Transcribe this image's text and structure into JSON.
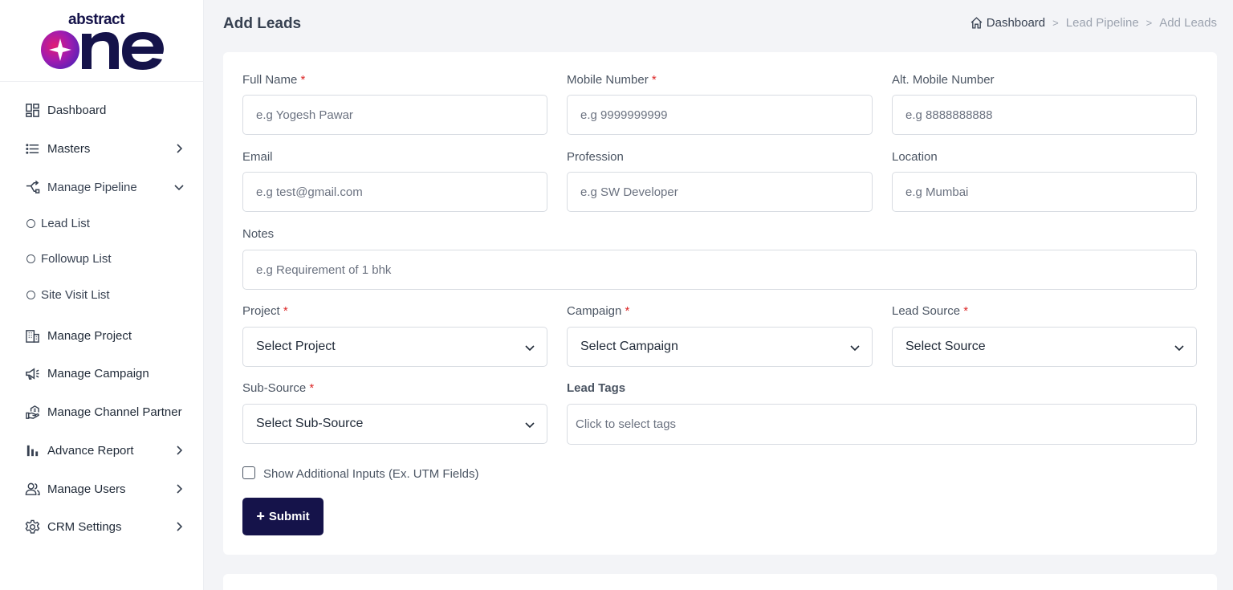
{
  "app": {
    "logo_top": "abstract",
    "logo_bottom": "one"
  },
  "sidebar": {
    "items": [
      {
        "label": "Dashboard",
        "icon": "dashboard-icon"
      },
      {
        "label": "Masters",
        "icon": "list-icon"
      },
      {
        "label": "Manage Pipeline",
        "icon": "pipeline-icon"
      },
      {
        "label": "Manage Project",
        "icon": "building-icon"
      },
      {
        "label": "Manage Campaign",
        "icon": "megaphone-icon"
      },
      {
        "label": "Manage Channel Partner",
        "icon": "handshake-icon"
      },
      {
        "label": "Advance Report",
        "icon": "bar-chart-icon"
      },
      {
        "label": "Manage Users",
        "icon": "users-icon"
      },
      {
        "label": "CRM Settings",
        "icon": "gear-icon"
      }
    ],
    "pipeline_sub": [
      "Lead List",
      "Followup List",
      "Site Visit List"
    ]
  },
  "header": {
    "title": "Add Leads",
    "breadcrumb": [
      "Dashboard",
      "Lead Pipeline",
      "Add Leads"
    ],
    "sep": ">"
  },
  "form": {
    "full_name": {
      "label": "Full Name",
      "placeholder": "e.g Yogesh Pawar",
      "required": "*"
    },
    "mobile": {
      "label": "Mobile Number",
      "placeholder": "e.g 9999999999",
      "required": "*"
    },
    "alt_mobile": {
      "label": "Alt. Mobile Number",
      "placeholder": "e.g 8888888888"
    },
    "email": {
      "label": "Email",
      "placeholder": "e.g test@gmail.com"
    },
    "profession": {
      "label": "Profession",
      "placeholder": "e.g SW Developer"
    },
    "location": {
      "label": "Location",
      "placeholder": "e.g Mumbai"
    },
    "notes": {
      "label": "Notes",
      "placeholder": "e.g Requirement of 1 bhk"
    },
    "project": {
      "label": "Project",
      "value": "Select Project",
      "required": "*"
    },
    "campaign": {
      "label": "Campaign",
      "value": "Select Campaign",
      "required": "*"
    },
    "lead_source": {
      "label": "Lead Source",
      "value": "Select Source",
      "required": "*"
    },
    "sub_source": {
      "label": "Sub-Source",
      "value": "Select Sub-Source",
      "required": "*"
    },
    "lead_tags": {
      "label": "Lead Tags",
      "placeholder": "Click to select tags"
    },
    "additional_inputs": "Show Additional Inputs (Ex. UTM Fields)",
    "submit_label": "Submit",
    "submit_icon": "+"
  },
  "colors": {
    "primary": "#15134a",
    "required": "#dc2626",
    "logo_gradient": [
      "#e11d74",
      "#6d28d9"
    ]
  }
}
